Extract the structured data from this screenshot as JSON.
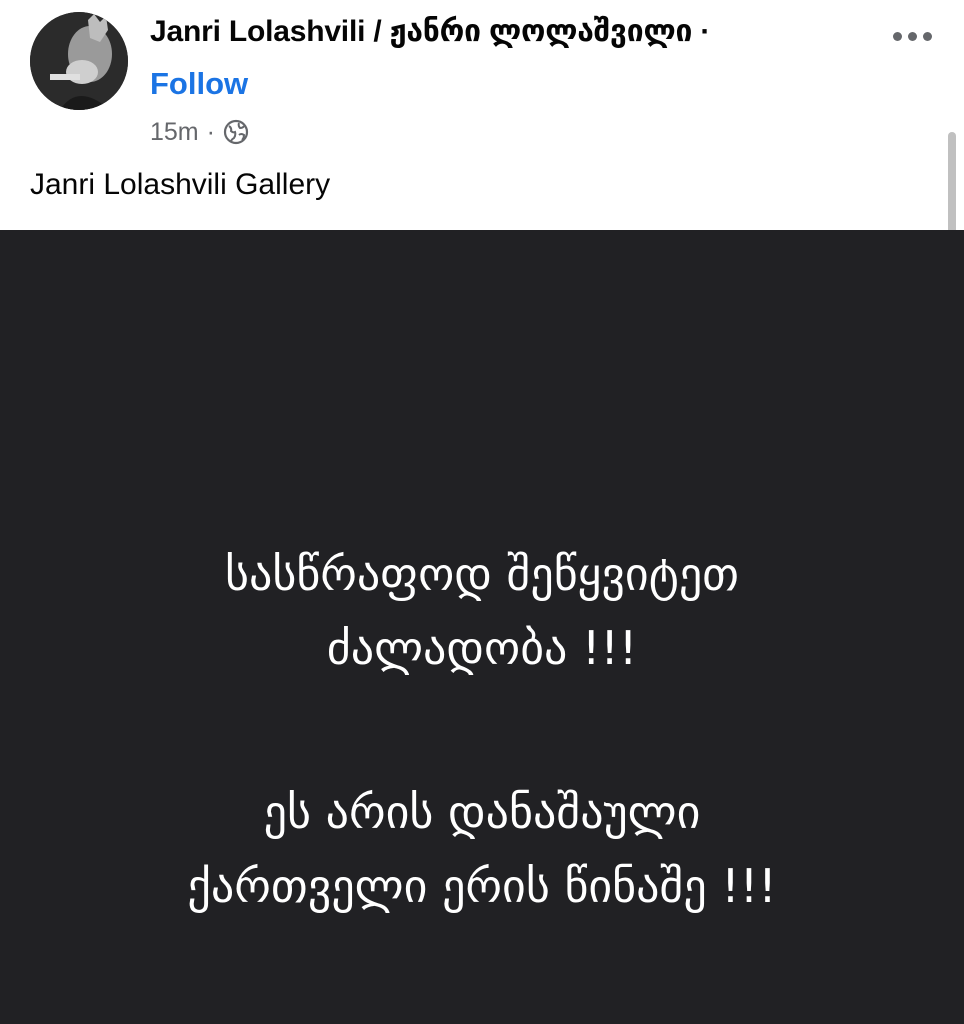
{
  "post": {
    "author_latin": "Janri Lolashvili",
    "separator": "/",
    "author_georgian": "ჟანრი ლოლაშვილი",
    "name_dot": "·",
    "follow_label": "Follow",
    "time": "15m",
    "meta_dot": "·",
    "audience_icon": "globe-icon",
    "more_icon": "more-options-icon",
    "caption": "Janri Lolashvili Gallery"
  },
  "image": {
    "lines": [
      "სასწრაფოდ შეწყვიტეთ",
      "ძალადობა !!!",
      "ეს არის დანაშაული",
      "ქართველი ერის წინაშე !!!"
    ]
  },
  "colors": {
    "follow": "#1b74e4",
    "image_background": "#212124",
    "meta_text": "#65676b",
    "name_text": "#050505"
  }
}
